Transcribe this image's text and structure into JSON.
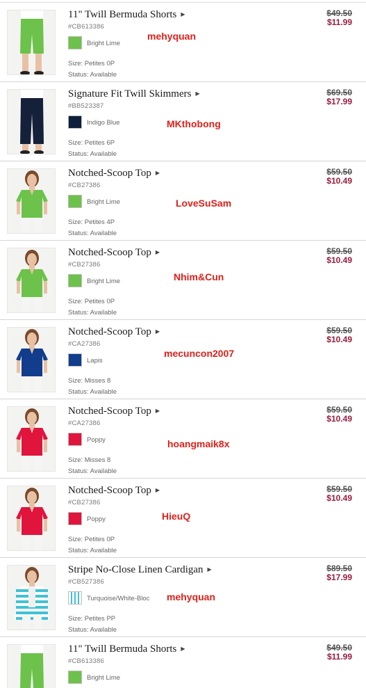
{
  "colors": {
    "price_sale": "#9b1b3c",
    "price_original": "#555555",
    "username_text": "#e0201a",
    "divider": "#d4d4d4"
  },
  "items": [
    {
      "name": "11\" Twill Bermuda Shorts",
      "sku": "#CB613386",
      "color": "Bright Lime",
      "swatch": "#6cc24a",
      "size": "Size: Petites  0P",
      "status": "Status: Available",
      "old_price": "$49.50",
      "new_price": "$11.99",
      "username": "mehyquan",
      "image": "green-shorts"
    },
    {
      "name": "Signature Fit Twill Skimmers",
      "sku": "#BB523387",
      "color": "Indigo Blue",
      "swatch": "#0d1f3a",
      "size": "Size: Petites  6P",
      "status": "Status: Available",
      "old_price": "$69.50",
      "new_price": "$17.99",
      "username": "MKthobong",
      "image": "navy-skimmers"
    },
    {
      "name": "Notched-Scoop Top",
      "sku": "#CB27386",
      "color": "Bright Lime",
      "swatch": "#6cc24a",
      "size": "Size: Petites  4P",
      "status": "Status: Available",
      "old_price": "$59.50",
      "new_price": "$10.49",
      "username": "LoveSuSam",
      "image": "green-top"
    },
    {
      "name": "Notched-Scoop Top",
      "sku": "#CB27386",
      "color": "Bright Lime",
      "swatch": "#6cc24a",
      "size": "Size: Petites  0P",
      "status": "Status: Available",
      "old_price": "$59.50",
      "new_price": "$10.49",
      "username": "Nhim&Cun",
      "image": "green-top"
    },
    {
      "name": "Notched-Scoop Top",
      "sku": "#CA27386",
      "color": "Lapis",
      "swatch": "#123c8c",
      "size": "Size: Misses  8",
      "status": "Status: Available",
      "old_price": "$59.50",
      "new_price": "$10.49",
      "username": "mecuncon2007",
      "image": "blue-top"
    },
    {
      "name": "Notched-Scoop Top",
      "sku": "#CA27386",
      "color": "Poppy",
      "swatch": "#e0143c",
      "size": "Size: Misses  8",
      "status": "Status: Available",
      "old_price": "$59.50",
      "new_price": "$10.49",
      "username": "hoangmaik8x",
      "image": "red-top"
    },
    {
      "name": "Notched-Scoop Top",
      "sku": "#CB27386",
      "color": "Poppy",
      "swatch": "#e0143c",
      "size": "Size: Petites  0P",
      "status": "Status: Available",
      "old_price": "$59.50",
      "new_price": "$10.49",
      "username": "HieuQ",
      "image": "red-top"
    },
    {
      "name": "Stripe No-Close Linen Cardigan",
      "sku": "#CB527386",
      "color": "Turquoise/White-Bloc",
      "swatch": "stripe",
      "size": "Size: Petites  PP",
      "status": "Status: Available",
      "old_price": "$89.50",
      "new_price": "$17.99",
      "username": "mehyquan",
      "image": "stripe-cardigan"
    },
    {
      "name": "11\" Twill Bermuda Shorts",
      "sku": "#CB613386",
      "color": "Bright Lime",
      "swatch": "#6cc24a",
      "size": "",
      "status": "",
      "old_price": "$49.50",
      "new_price": "$11.99",
      "username": "",
      "image": "green-shorts"
    }
  ]
}
